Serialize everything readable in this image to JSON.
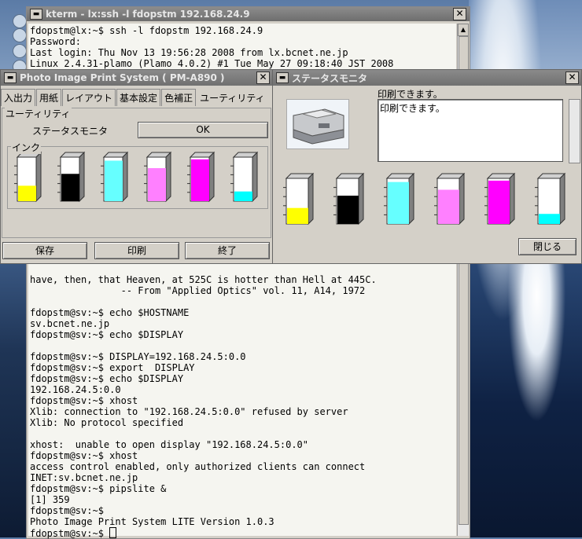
{
  "desktop": {
    "icons": [
      "app-icon",
      "app-icon",
      "app-icon",
      "app-icon"
    ]
  },
  "xterm": {
    "title": "kterm - lx:ssh -l fdopstm 192.168.24.9",
    "lines_top": [
      "fdopstm@lx:~$ ssh -l fdopstm 192.168.24.9",
      "Password:",
      "Last login: Thu Nov 13 19:56:28 2008 from lx.bcnet.ne.jp",
      "Linux 2.4.31-plamo (Plamo 4.0.2) #1 Tue May 27 09:18:40 JST 2008"
    ],
    "lines_bottom": [
      "have, then, that Heaven, at 525C is hotter than Hell at 445C.",
      "                -- From \"Applied Optics\" vol. 11, A14, 1972",
      "",
      "fdopstm@sv:~$ echo $HOSTNAME",
      "sv.bcnet.ne.jp",
      "fdopstm@sv:~$ echo $DISPLAY",
      "",
      "fdopstm@sv:~$ DISPLAY=192.168.24.5:0.0",
      "fdopstm@sv:~$ export  DISPLAY",
      "fdopstm@sv:~$ echo $DISPLAY",
      "192.168.24.5:0.0",
      "fdopstm@sv:~$ xhost",
      "Xlib: connection to \"192.168.24.5:0.0\" refused by server",
      "Xlib: No protocol specified",
      "",
      "xhost:  unable to open display \"192.168.24.5:0.0\"",
      "fdopstm@sv:~$ xhost",
      "access control enabled, only authorized clients can connect",
      "INET:sv.bcnet.ne.jp",
      "fdopstm@sv:~$ pipslite &",
      "[1] 359",
      "fdopstm@sv:~$",
      "Photo Image Print System LITE Version 1.0.3"
    ],
    "prompt": "fdopstm@sv:~$ "
  },
  "pm_window": {
    "title": "Photo Image Print System ( PM-A890 )",
    "tabs": [
      "入出力",
      "用紙",
      "レイアウト",
      "基本設定",
      "色補正",
      "ユーティリティ"
    ],
    "active_tab": 5,
    "group_utility": "ユーティリティ",
    "status_monitor_label": "ステータスモニタ",
    "ok_label": "OK",
    "group_ink": "インク",
    "buttons": {
      "save": "保存",
      "print": "印刷",
      "exit": "終了"
    }
  },
  "status_window": {
    "title": "ステータスモニタ",
    "message_label": "印刷できます。",
    "message_text": "印刷できます。",
    "close_label": "閉じる"
  },
  "inks": [
    {
      "name": "yellow",
      "color": "#ffff00",
      "level": 0.35
    },
    {
      "name": "black",
      "color": "#000000",
      "level": 0.62
    },
    {
      "name": "cyan",
      "color": "#66ffff",
      "level": 0.92
    },
    {
      "name": "light-magenta",
      "color": "#ff80ff",
      "level": 0.75
    },
    {
      "name": "magenta",
      "color": "#ff00ff",
      "level": 0.95
    },
    {
      "name": "light-cyan",
      "color": "#00ffff",
      "level": 0.22
    }
  ]
}
